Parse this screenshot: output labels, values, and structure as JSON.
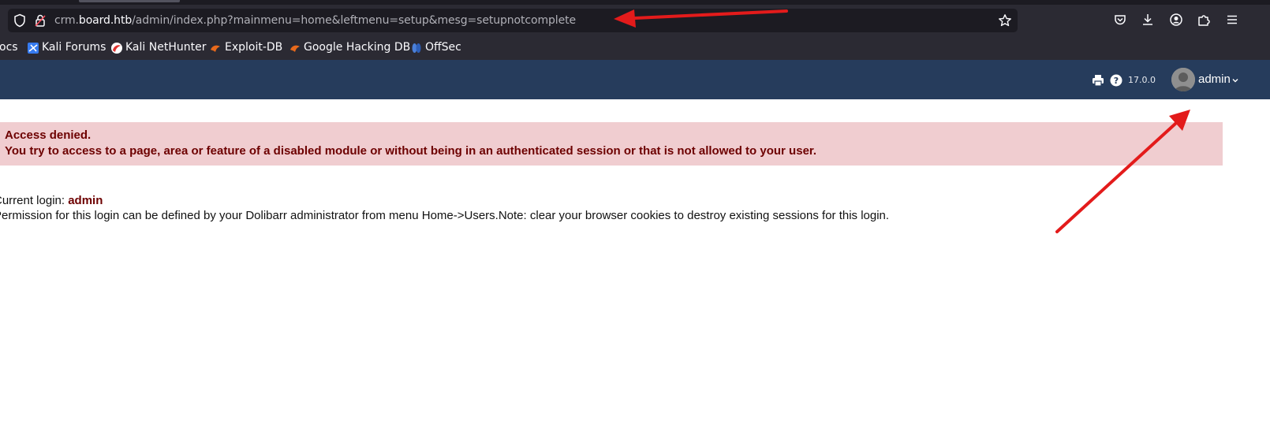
{
  "browser": {
    "url_prefix": "crm.",
    "url_host": "board.htb",
    "url_path": "/admin/index.php?mainmenu=home&leftmenu=setup&mesg=setupnotcomplete",
    "bookmarks": [
      {
        "label": "ocs",
        "icon": "docs-icon"
      },
      {
        "label": "Kali Forums",
        "icon": "kali-forums-icon"
      },
      {
        "label": "Kali NetHunter",
        "icon": "kali-nethunter-icon"
      },
      {
        "label": "Exploit-DB",
        "icon": "exploit-db-icon"
      },
      {
        "label": "Google Hacking DB",
        "icon": "ghdb-icon"
      },
      {
        "label": "OffSec",
        "icon": "offsec-icon"
      }
    ],
    "toolbar_icons": [
      "pocket-icon",
      "downloads-icon",
      "account-icon",
      "extensions-icon",
      "menu-icon"
    ]
  },
  "topbar": {
    "version": "17.0.0",
    "username": "admin",
    "icons": [
      "print-icon",
      "help-icon",
      "avatar",
      "chevron-down-icon"
    ]
  },
  "error": {
    "title": "Access denied.",
    "message": "You try to access to a page, area or feature of a disabled module or without being in an authenticated session or that is not allowed to your user."
  },
  "info": {
    "login_label": "Current login: ",
    "login_user": "admin",
    "permission_text": "Permission for this login can be defined by your Dolibarr administrator from menu Home->Users.Note: clear your browser cookies to destroy existing sessions for this login."
  },
  "colors": {
    "topbar_bg": "#263c5c",
    "error_bg": "#f0cdd0",
    "error_text": "#6d0000",
    "annotation_arrow": "#e31b1b"
  }
}
